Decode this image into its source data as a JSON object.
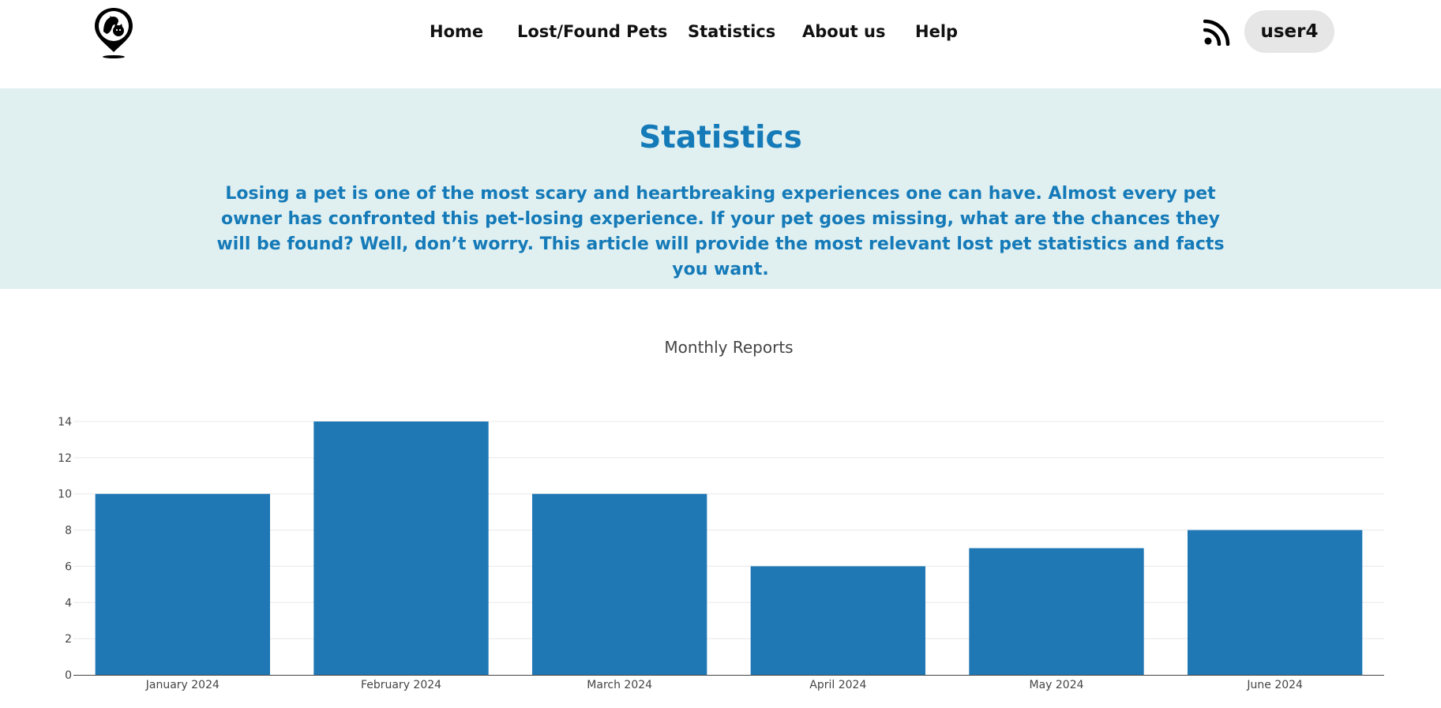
{
  "header": {
    "logo_icon": "pet-location-pin-icon",
    "nav": [
      {
        "label": "Home"
      },
      {
        "label": "Lost/Found Pets"
      },
      {
        "label": "Statistics"
      },
      {
        "label": "About us"
      },
      {
        "label": "Help"
      }
    ],
    "rss_icon": "rss-feed-icon",
    "user_label": "user4"
  },
  "banner": {
    "title": "Statistics",
    "text": "Losing a pet is one of the most scary and heartbreaking experiences one can have. Almost every pet owner has confronted this pet-losing experience. If your pet goes missing, what are the chances they will be found? Well, don’t worry. This article will provide the most relevant lost pet statistics and facts you want."
  },
  "colors": {
    "accent": "#157ab8",
    "banner_bg": "#e0f0f1",
    "bar": "#1f77b4",
    "pill_bg": "#e6e6e6"
  },
  "chart_data": {
    "type": "bar",
    "title": "Monthly Reports",
    "categories": [
      "January 2024",
      "February 2024",
      "March 2024",
      "April 2024",
      "May 2024",
      "June 2024"
    ],
    "values": [
      10,
      14,
      10,
      6,
      7,
      8
    ],
    "ylim": [
      0,
      14
    ],
    "yticks": [
      0,
      2,
      4,
      6,
      8,
      10,
      12,
      14
    ],
    "grid": true,
    "legend": "none"
  }
}
